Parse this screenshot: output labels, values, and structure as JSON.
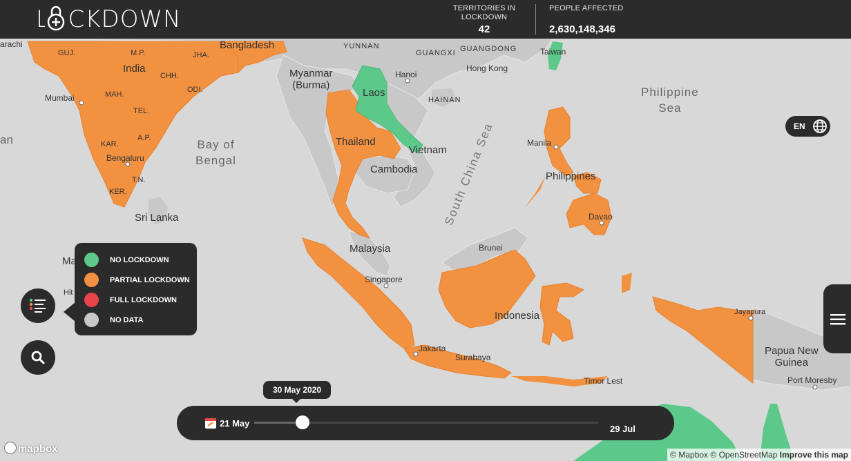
{
  "header": {
    "logo": "LOCKDOWN",
    "territories_label_1": "TERRITORIES IN",
    "territories_label_2": "LOCKDOWN",
    "territories_value": "42",
    "people_label": "PEOPLE AFFECTED",
    "people_value": "2,630,148,346"
  },
  "colors": {
    "no_lockdown": "#5cc98a",
    "partial_lockdown": "#f29140",
    "full_lockdown": "#e8454b",
    "no_data": "#c8c8c8",
    "panel": "#2b2b2b",
    "water": "#d8d8d8"
  },
  "legend": {
    "items": [
      {
        "label": "NO LOCKDOWN",
        "color": "#5cc98a"
      },
      {
        "label": "PARTIAL LOCKDOWN",
        "color": "#f29140"
      },
      {
        "label": "FULL LOCKDOWN",
        "color": "#e8454b"
      },
      {
        "label": "NO DATA",
        "color": "#c8c8c8"
      }
    ]
  },
  "language": {
    "code": "EN",
    "icon": "globe-icon"
  },
  "icons": {
    "legend_toggle": "list-icon",
    "search": "search-icon",
    "menu": "hamburger-icon",
    "calendar": "calendar-icon",
    "logo_lock": "padlock-icon"
  },
  "timeline": {
    "current_date": "30 May 2020",
    "start_date": "21 May",
    "end_date": "29 Jul",
    "progress": 0.14
  },
  "map_labels": {
    "achi": "arachi",
    "guj": "GUJ.",
    "mp": "M.P.",
    "jha": "JHA.",
    "bangladesh": "Bangladesh",
    "yunnan": "YUNNAN",
    "guangxi": "GUANGXI",
    "guangdong": "GUANGDONG",
    "taiwan": "Taiwan",
    "india": "India",
    "myanmar": "Myanmar\n(Burma)",
    "hanoi": "Hanoi",
    "hong_kong": "Hong Kong",
    "chh": "CHH.",
    "mumbai": "Mumbai",
    "mah": "MAH.",
    "odi": "ODI.",
    "laos": "Laos",
    "hainan": "HAINAN",
    "philippine_sea": "Philippine\nSea",
    "tel": "TEL.",
    "an": "an",
    "bay_of_bengal": "Bay of\nBengal",
    "thailand": "Thailand",
    "vietnam": "Vietnam",
    "manila": "Manila",
    "kar": "KAR.",
    "ap": "A.P.",
    "bengaluru": "Bengaluru",
    "cambodia": "Cambodia",
    "tn": "T.N.",
    "philippines": "Philippines",
    "south_china_sea": "South China Sea",
    "ker": "KER.",
    "sri_lanka": "Sri Lanka",
    "davao": "Davao",
    "malaysia": "Malaysia",
    "brunei": "Brunei",
    "ma": "Ma",
    "hi": "Hit",
    "singapore": "Singapore",
    "indonesia": "Indonesia",
    "jayapura": "Jayapura",
    "jakarta": "Jakarta",
    "surabaya": "Surabaya",
    "papua": "Papua New\nGuinea",
    "timor": "Timor Lest",
    "port_moresby": "Port Moresby"
  },
  "attribution": {
    "mapbox": "© Mapbox",
    "osm": "© OpenStreetMap",
    "improve": "Improve this map",
    "logo": "mapbox"
  }
}
